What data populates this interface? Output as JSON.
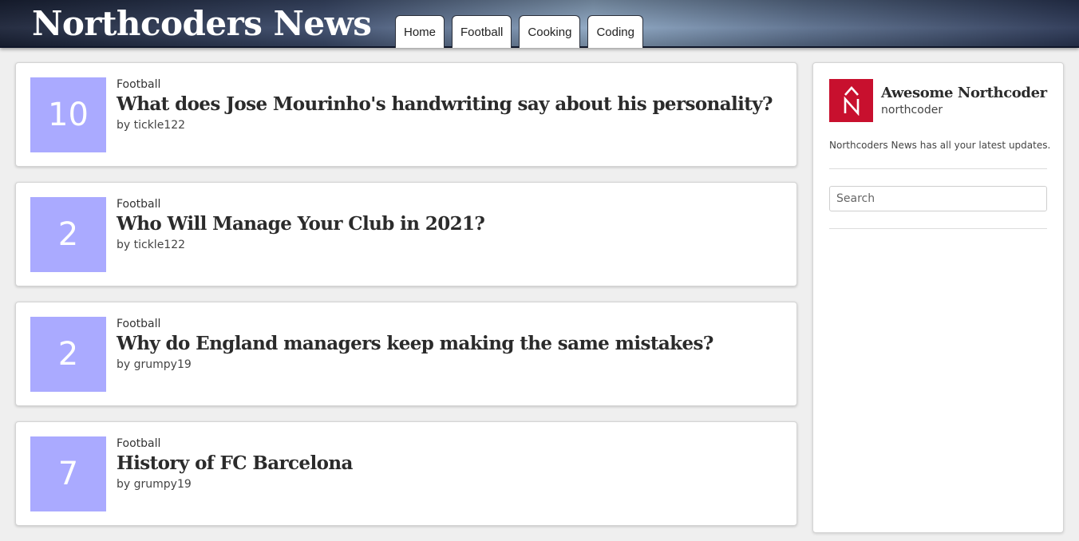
{
  "header": {
    "site_title": "Northcoders News",
    "nav_tabs": [
      {
        "label": "Home"
      },
      {
        "label": "Football"
      },
      {
        "label": "Cooking"
      },
      {
        "label": "Coding"
      }
    ]
  },
  "articles": [
    {
      "votes": "10",
      "topic": "Football",
      "title": "What does Jose Mourinho's handwriting say about his personality?",
      "author": "by tickle122"
    },
    {
      "votes": "2",
      "topic": "Football",
      "title": "Who Will Manage Your Club in 2021?",
      "author": "by tickle122"
    },
    {
      "votes": "2",
      "topic": "Football",
      "title": "Why do England managers keep making the same mistakes?",
      "author": "by grumpy19"
    },
    {
      "votes": "7",
      "topic": "Football",
      "title": "History of FC Barcelona",
      "author": "by grumpy19"
    }
  ],
  "sidebar": {
    "profile_name": "Awesome Northcoder",
    "profile_username": "northcoder",
    "logo_icon": "northcoders-logo",
    "description": "Northcoders News has all your latest updates.",
    "search": {
      "placeholder": "Search",
      "value": ""
    }
  },
  "colors": {
    "vote_box": "#aaaaff",
    "logo_red": "#c8102e",
    "page_bg": "#efefef"
  }
}
